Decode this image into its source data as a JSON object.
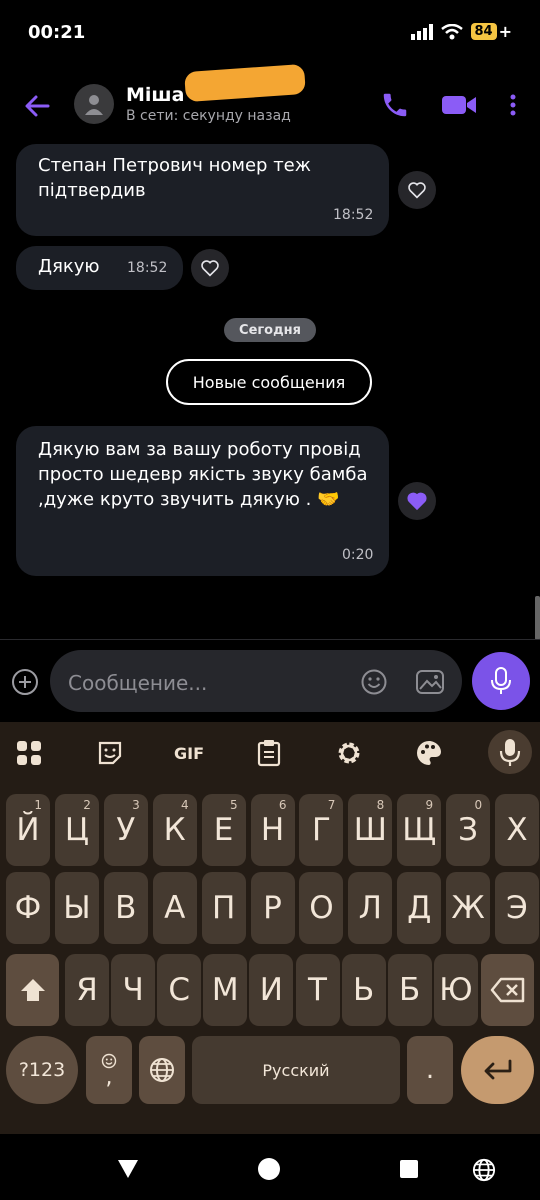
{
  "status_bar": {
    "time": "00:21",
    "battery": "84",
    "battery_suffix": "+"
  },
  "header": {
    "contact_name": "Міша",
    "contact_status": "В сети: секунду назад",
    "icons": [
      "back-arrow-icon",
      "avatar-icon",
      "phone-icon",
      "video-camera-icon",
      "more-vertical-icon"
    ],
    "accent_color": "#8b5cf6"
  },
  "messages": [
    {
      "text": "Степан Петрович номер теж підтвердив",
      "time": "18:52",
      "reaction": "heart-outline-icon"
    },
    {
      "text": "Дякую",
      "time": "18:52",
      "reaction": "heart-outline-icon"
    },
    {
      "text": "Дякую вам за вашу роботу провід просто шедевр якість звуку бамба ,дуже круто звучить дякую . 🤝",
      "time": "0:20",
      "reaction": "heart-filled-icon"
    }
  ],
  "date_separator": "Сегодня",
  "new_messages_label": "Новые сообщения",
  "composer": {
    "placeholder": "Сообщение...",
    "send_button_color": "#7b53e8"
  },
  "keyboard": {
    "toolbar": [
      "apps-grid-icon",
      "sticker-icon",
      "gif-icon",
      "clipboard-icon",
      "settings-gear-icon",
      "palette-icon",
      "mic-icon"
    ],
    "gif_label": "GIF",
    "rows": [
      [
        "Й",
        "Ц",
        "У",
        "К",
        "Е",
        "Н",
        "Г",
        "Ш",
        "Щ",
        "З",
        "Х"
      ],
      [
        "Ф",
        "Ы",
        "В",
        "А",
        "П",
        "Р",
        "О",
        "Л",
        "Д",
        "Ж",
        "Э"
      ],
      [
        "Я",
        "Ч",
        "С",
        "М",
        "И",
        "Т",
        "Ь",
        "Б",
        "Ю"
      ]
    ],
    "number_hints": [
      "1",
      "2",
      "3",
      "4",
      "5",
      "6",
      "7",
      "8",
      "9",
      "0"
    ],
    "symbols_label": "?123",
    "comma_label": ",",
    "space_label": "Русский",
    "period_label": "."
  },
  "nav_bar": [
    "back-triangle-icon",
    "home-circle-icon",
    "recents-square-icon",
    "globe-icon"
  ]
}
